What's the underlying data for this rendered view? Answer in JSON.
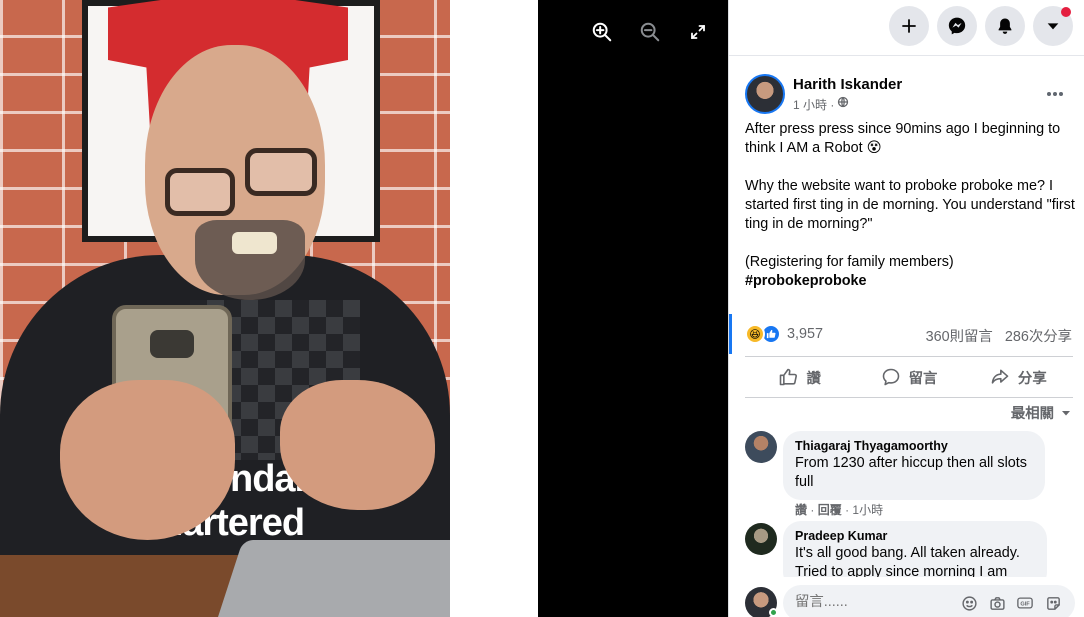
{
  "viewer": {
    "zoom_in_icon": "zoom-in-icon",
    "zoom_out_icon": "zoom-out-icon",
    "fullscreen_icon": "fullscreen-icon",
    "photo_text_line1": "ndard",
    "photo_text_line2": "hartered"
  },
  "topbar": {
    "create_icon": "plus-icon",
    "messenger_icon": "messenger-icon",
    "notifications_icon": "bell-icon",
    "account_icon": "caret-down-icon",
    "accent_color": "#e41e3f"
  },
  "post": {
    "author": "Harith Iskander",
    "time": "1 小時 · ",
    "text_p1": "After press press since 90mins ago I beginning to think I AM a Robot 😵",
    "text_p2": "Why the website want to proboke proboke me? I started first ting in de morning. You understand \"first ting in de morning?\"",
    "text_p3": "(Registering for family members)",
    "hashtag": "#probokeproboke",
    "reaction_count": "3,957",
    "comment_count": "360則留言",
    "share_count": "286次分享"
  },
  "actions": {
    "like": "讚",
    "comment": "留言",
    "share": "分享"
  },
  "sort_label": "最相關",
  "comments": [
    {
      "name": "Thiagaraj Thyagamoorthy",
      "text": "From 1230 after hiccup then all slots full",
      "like": "讚",
      "reply": "回覆",
      "time": "1小時"
    },
    {
      "name": "Pradeep Kumar",
      "text": "It's all good bang. All taken already. Tried to apply since morning I am"
    }
  ],
  "composer": {
    "placeholder": "留言......"
  },
  "colors": {
    "brand_blue": "#1877f2",
    "secondary_text": "#65676b"
  }
}
